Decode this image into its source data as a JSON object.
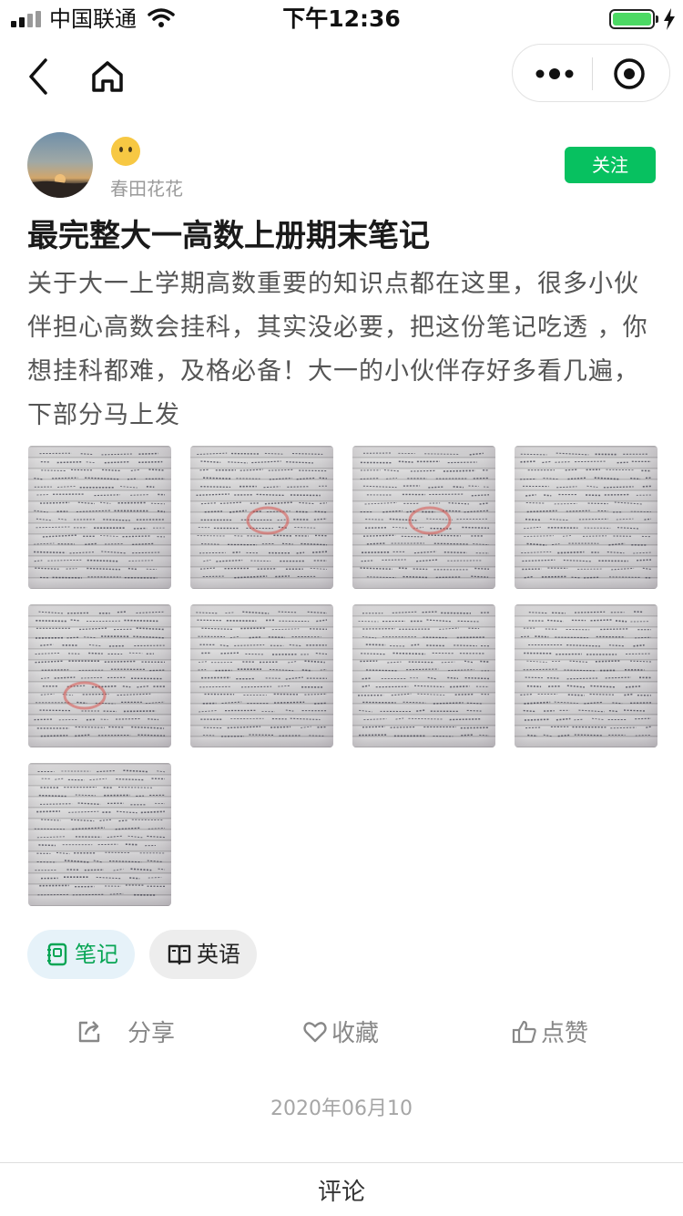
{
  "status_bar": {
    "carrier": "中国联通",
    "time": "下午12:36",
    "battery_level": 1.0
  },
  "nav": {
    "back_icon": "chevron-left-icon",
    "home_icon": "home-icon",
    "more_icon": "more-dots-icon",
    "close_icon": "target-close-icon"
  },
  "author": {
    "name": "春田花花",
    "emoji": "😶",
    "follow_label": "关注"
  },
  "post": {
    "title": "最完整大一高数上册期末笔记",
    "description": "关于大一上学期高数重要的知识点都在这里，很多小伙伴担心高数会挂科，其实没必要，把这份笔记吃透 ，你想挂科都难，及格必备！大一的小伙伴存好多看几遍，下部分马上发",
    "image_count": 9
  },
  "tags": [
    {
      "label": "笔记",
      "icon": "notebook-icon"
    },
    {
      "label": "英语",
      "icon": "book-open-icon"
    }
  ],
  "actions": {
    "share_label": "分享",
    "favorite_label": "收藏",
    "like_label": "点赞"
  },
  "date": "2020年06月10",
  "bottom": {
    "comment_label": "评论"
  },
  "colors": {
    "accent_green": "#07c160",
    "tag_note_bg": "#e6f2f9",
    "tag_english_bg": "#ededed"
  }
}
